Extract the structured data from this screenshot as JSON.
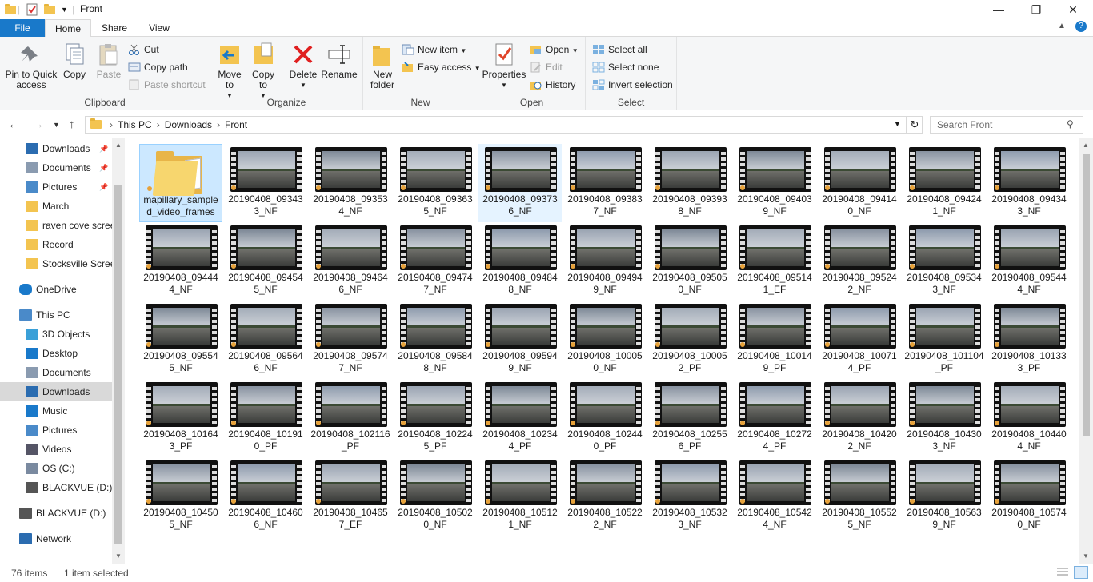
{
  "window": {
    "title": "Front",
    "controls": {
      "minimize": "—",
      "maximize": "❐",
      "close": "✕"
    }
  },
  "tabs": {
    "file": "File",
    "home": "Home",
    "share": "Share",
    "view": "View"
  },
  "ribbon": {
    "clipboard": {
      "label": "Clipboard",
      "pin": "Pin to Quick access",
      "copy": "Copy",
      "paste": "Paste",
      "cut": "Cut",
      "copy_path": "Copy path",
      "paste_shortcut": "Paste shortcut"
    },
    "organize": {
      "label": "Organize",
      "move_to": "Move to",
      "copy_to": "Copy to",
      "delete": "Delete",
      "rename": "Rename"
    },
    "new": {
      "label": "New",
      "new_folder": "New folder",
      "new_item": "New item",
      "easy_access": "Easy access"
    },
    "open": {
      "label": "Open",
      "properties": "Properties",
      "open": "Open",
      "edit": "Edit",
      "history": "History"
    },
    "select": {
      "label": "Select",
      "select_all": "Select all",
      "select_none": "Select none",
      "invert": "Invert selection"
    }
  },
  "address": {
    "crumbs": [
      "This PC",
      "Downloads",
      "Front"
    ],
    "search_placeholder": "Search Front"
  },
  "nav": [
    {
      "label": "Downloads",
      "pinned": true,
      "icon": "download-icon"
    },
    {
      "label": "Documents",
      "pinned": true,
      "icon": "document-icon"
    },
    {
      "label": "Pictures",
      "pinned": true,
      "icon": "picture-icon"
    },
    {
      "label": "March",
      "icon": "folder-icon"
    },
    {
      "label": "raven cove screenshots",
      "icon": "folder-icon"
    },
    {
      "label": "Record",
      "icon": "folder-icon"
    },
    {
      "label": "Stocksville Screenshots",
      "icon": "folder-icon"
    },
    {
      "label": "OneDrive",
      "icon": "cloud-icon",
      "top": true
    },
    {
      "label": "This PC",
      "icon": "computer-icon",
      "top": true
    },
    {
      "label": "3D Objects",
      "icon": "cube-icon"
    },
    {
      "label": "Desktop",
      "icon": "desktop-icon"
    },
    {
      "label": "Documents",
      "icon": "document-icon"
    },
    {
      "label": "Downloads",
      "icon": "download-icon",
      "selected": true
    },
    {
      "label": "Music",
      "icon": "music-icon"
    },
    {
      "label": "Pictures",
      "icon": "picture-icon"
    },
    {
      "label": "Videos",
      "icon": "video-icon"
    },
    {
      "label": "OS (C:)",
      "icon": "drive-icon"
    },
    {
      "label": "BLACKVUE (D:)",
      "icon": "usb-drive-icon"
    },
    {
      "label": "BLACKVUE (D:)",
      "icon": "usb-drive-icon",
      "top": true
    },
    {
      "label": "Network",
      "icon": "network-icon",
      "top": true
    }
  ],
  "files": [
    "mapillary_sampled_video_frames",
    "20190408_093433_NF",
    "20190408_093534_NF",
    "20190408_093635_NF",
    "20190408_093736_NF",
    "20190408_093837_NF",
    "20190408_093938_NF",
    "20190408_094039_NF",
    "20190408_094140_NF",
    "20190408_094241_NF",
    "20190408_094343_NF",
    "20190408_094444_NF",
    "20190408_094545_NF",
    "20190408_094646_NF",
    "20190408_094747_NF",
    "20190408_094848_NF",
    "20190408_094949_NF",
    "20190408_095050_NF",
    "20190408_095141_EF",
    "20190408_095242_NF",
    "20190408_095343_NF",
    "20190408_095444_NF",
    "20190408_095545_NF",
    "20190408_095646_NF",
    "20190408_095747_NF",
    "20190408_095848_NF",
    "20190408_095949_NF",
    "20190408_100050_NF",
    "20190408_100052_PF",
    "20190408_100149_PF",
    "20190408_100714_PF",
    "20190408_101104_PF",
    "20190408_101333_PF",
    "20190408_101643_PF",
    "20190408_101910_PF",
    "20190408_102116_PF",
    "20190408_102245_PF",
    "20190408_102344_PF",
    "20190408_102440_PF",
    "20190408_102556_PF",
    "20190408_102724_PF",
    "20190408_104202_NF",
    "20190408_104303_NF",
    "20190408_104404_NF",
    "20190408_104505_NF",
    "20190408_104606_NF",
    "20190408_104657_EF",
    "20190408_105020_NF",
    "20190408_105121_NF",
    "20190408_105222_NF",
    "20190408_105323_NF",
    "20190408_105424_NF",
    "20190408_105525_NF",
    "20190408_105639_NF",
    "20190408_105740_NF"
  ],
  "selected_index": 0,
  "hover_index": 4,
  "status": {
    "count": "76 items",
    "selected": "1 item selected"
  },
  "colors": {
    "accent": "#1979ca",
    "selection": "#cce8ff",
    "folder": "#f3c450"
  }
}
